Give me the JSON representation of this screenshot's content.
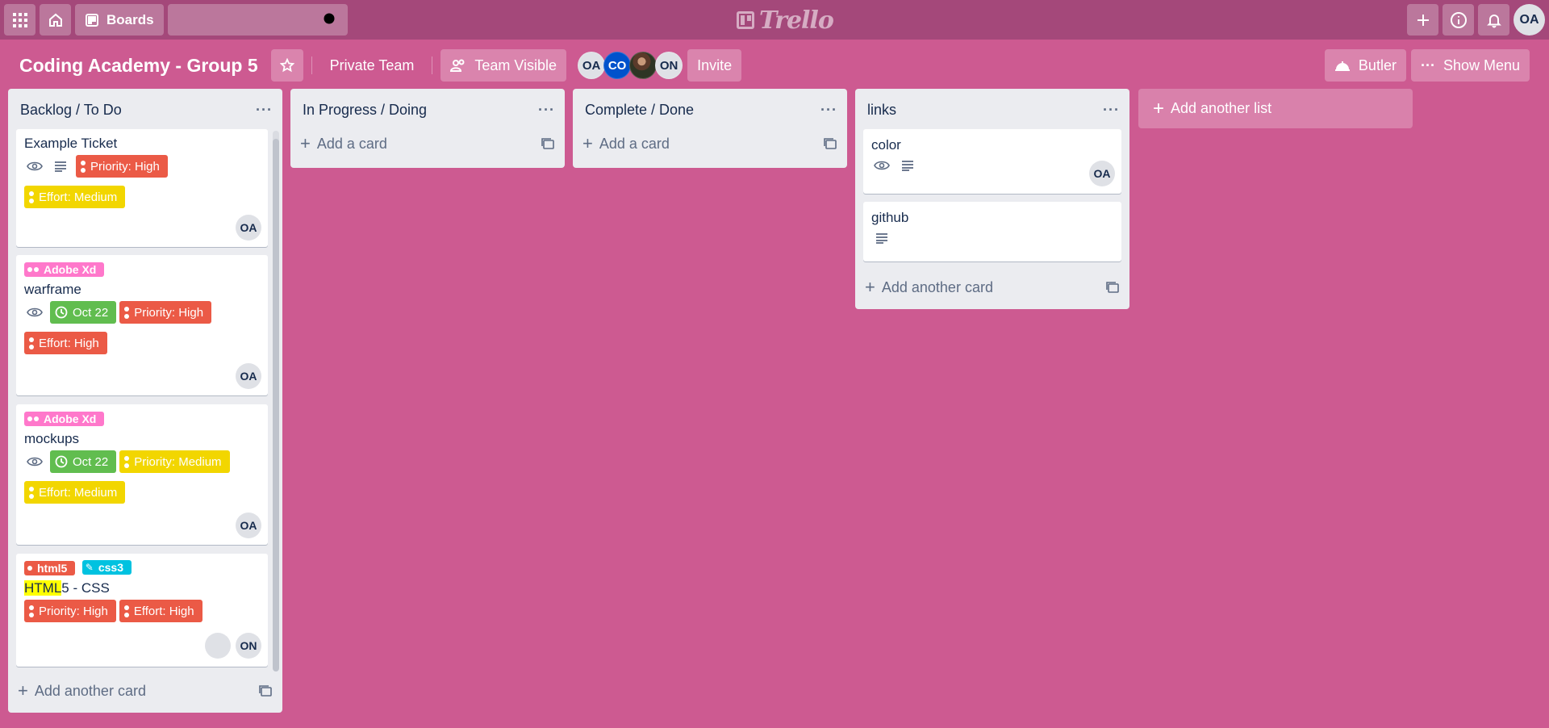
{
  "header": {
    "boards_label": "Boards",
    "search_placeholder": "",
    "logo_text": "Trello",
    "user_initials": "OA"
  },
  "board": {
    "title": "Coding Academy - Group 5",
    "team_label": "Private Team",
    "visibility_label": "Team Visible",
    "members": [
      "OA",
      "CO",
      "",
      "ON"
    ],
    "invite_label": "Invite",
    "butler_label": "Butler",
    "menu_label": "Show Menu"
  },
  "lists": [
    {
      "title": "Backlog / To Do",
      "add_label": "Add another card",
      "cards": [
        {
          "title": "Example Ticket",
          "labels": [
            "Priority: High",
            "Effort: Medium"
          ],
          "member": "OA"
        },
        {
          "top_label": "Adobe Xd",
          "title": "warframe",
          "due": "Oct 22",
          "labels": [
            "Priority: High",
            "Effort: High"
          ],
          "member": "OA"
        },
        {
          "top_label": "Adobe Xd",
          "title": "mockups",
          "due": "Oct 22",
          "labels": [
            "Priority: Medium",
            "Effort: Medium"
          ],
          "member": "OA"
        },
        {
          "top_labels": [
            "html5",
            "css3"
          ],
          "title_highlight": "HTML",
          "title_rest": "5 - CSS",
          "labels": [
            "Priority: High",
            "Effort: High"
          ],
          "member": "ON"
        }
      ]
    },
    {
      "title": "In Progress / Doing",
      "add_label": "Add a card"
    },
    {
      "title": "Complete / Done",
      "add_label": "Add a card"
    },
    {
      "title": "links",
      "add_label": "Add another card",
      "cards": [
        {
          "title": "color",
          "member": "OA"
        },
        {
          "title": "github"
        }
      ]
    }
  ],
  "add_list_label": "Add another list",
  "colors": {
    "background": "#cd5a91",
    "header": "#a4487a",
    "red_label": "#eb5a46",
    "yellow_label": "#f2d600",
    "pink_label": "#ff78cb",
    "sky_label": "#00c2e0",
    "green_label": "#61bd4f"
  }
}
